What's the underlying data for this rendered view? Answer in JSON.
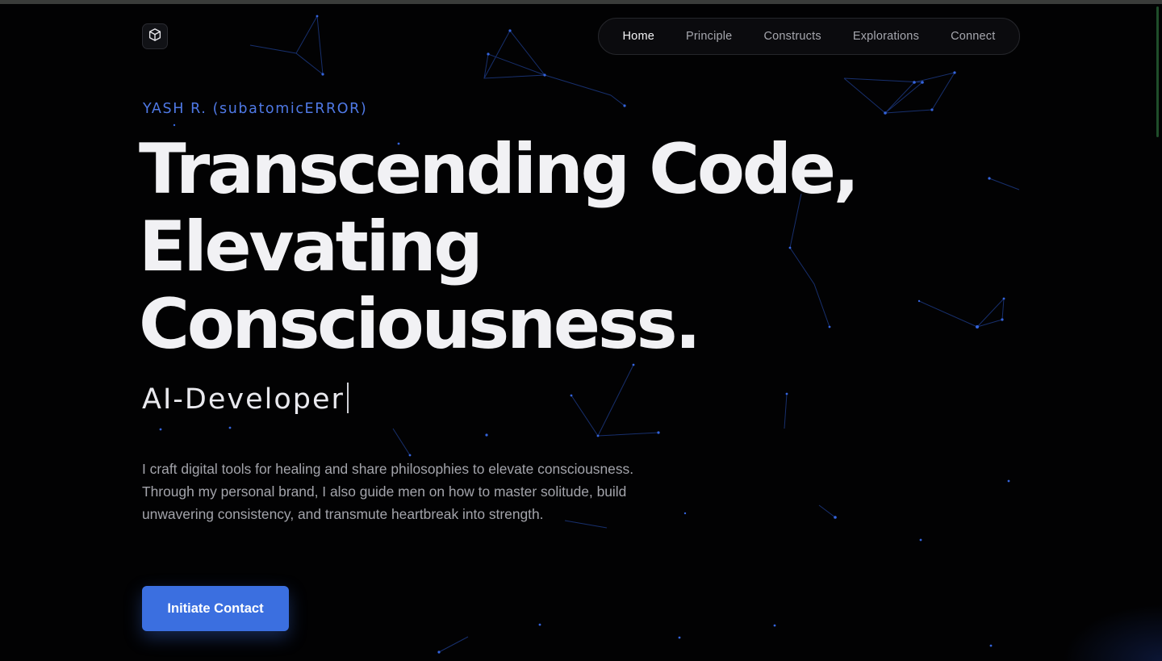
{
  "nav": {
    "items": [
      {
        "label": "Home",
        "active": true
      },
      {
        "label": "Principle",
        "active": false
      },
      {
        "label": "Constructs",
        "active": false
      },
      {
        "label": "Explorations",
        "active": false
      },
      {
        "label": "Connect",
        "active": false
      }
    ]
  },
  "hero": {
    "eyebrow": "YASH R. (subatomicERROR)",
    "headline": [
      "Transcending Code,",
      "Elevating",
      "Consciousness."
    ],
    "role": "AI-Developer",
    "bio": "I craft digital tools for healing and share philosophies to elevate consciousness. Through my personal brand, I also guide men on how to master solitude, build unwavering consistency, and transmute heartbreak into strength.",
    "cta_label": "Initiate Contact"
  },
  "theme": {
    "background": "#020203",
    "accent": "#3b6fe0",
    "eyebrow_color": "#4f79e6",
    "constellation_color": "#2b57c9"
  },
  "icons": {
    "logo": "cube-icon"
  }
}
